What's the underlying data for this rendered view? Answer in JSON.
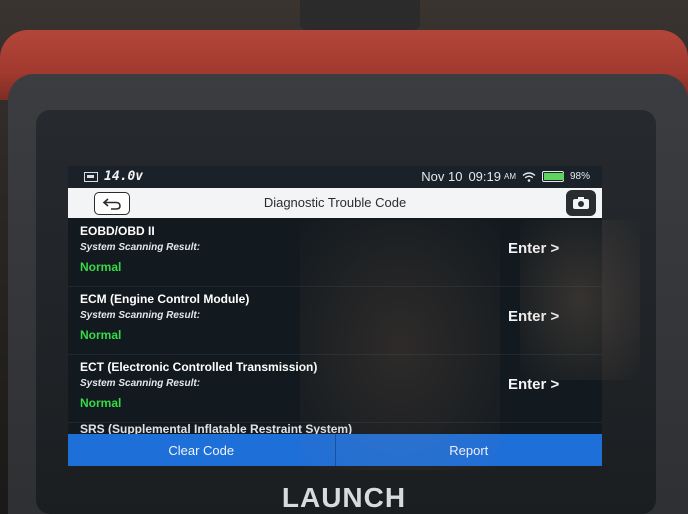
{
  "device": {
    "brand": "LAUNCH"
  },
  "status_bar": {
    "voltage": "14.0v",
    "date": "Nov 10",
    "time": "09:19",
    "ampm": "AM",
    "battery_percent": "98%",
    "battery_level": 0.98
  },
  "header": {
    "title": "Diagnostic Trouble Code"
  },
  "systems": [
    {
      "name": "EOBD/OBD II",
      "sub_label": "System Scanning Result:",
      "status": "Normal",
      "action": "Enter >"
    },
    {
      "name": "ECM (Engine Control Module)",
      "sub_label": "System Scanning Result:",
      "status": "Normal",
      "action": "Enter >"
    },
    {
      "name": "ECT (Electronic Controlled Transmission)",
      "sub_label": "System Scanning Result:",
      "status": "Normal",
      "action": "Enter >"
    },
    {
      "name": "SRS (Supplemental Inflatable Restraint System)"
    }
  ],
  "footer": {
    "clear_label": "Clear Code",
    "report_label": "Report"
  },
  "colors": {
    "primary": "#1f6fd8",
    "status_ok": "#36d946",
    "case": "#a23a2f"
  }
}
